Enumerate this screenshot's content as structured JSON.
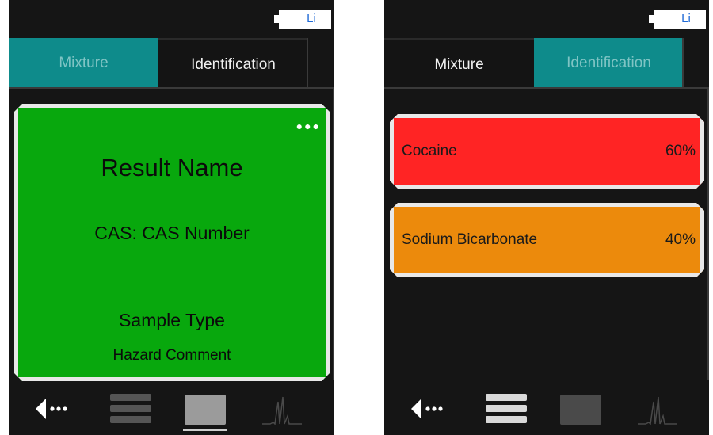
{
  "battery_label": "Li",
  "left": {
    "tabs": [
      {
        "label": "Mixture",
        "state": "active"
      },
      {
        "label": "Identification",
        "state": "inactive"
      }
    ],
    "result": {
      "name": "Result Name",
      "cas": "CAS: CAS Number",
      "sample_type": "Sample Type",
      "hazard": "Hazard Comment",
      "color": "#08a80d"
    }
  },
  "right": {
    "tabs": [
      {
        "label": "Mixture",
        "state": "inactive"
      },
      {
        "label": "Identification",
        "state": "active"
      }
    ],
    "mixture": [
      {
        "name": "Cocaine",
        "percent": "60%",
        "color": "#ff2424"
      },
      {
        "name": "Sodium Bicarbonate",
        "percent": "40%",
        "color": "#ec8a0c"
      }
    ]
  },
  "icons": {
    "back": "back-arrow-icon",
    "list": "list-view-icon",
    "tile": "tile-view-icon",
    "spectrum": "spectrum-icon"
  },
  "colors": {
    "accent_teal": "#0e8b8b",
    "background": "#151515"
  }
}
